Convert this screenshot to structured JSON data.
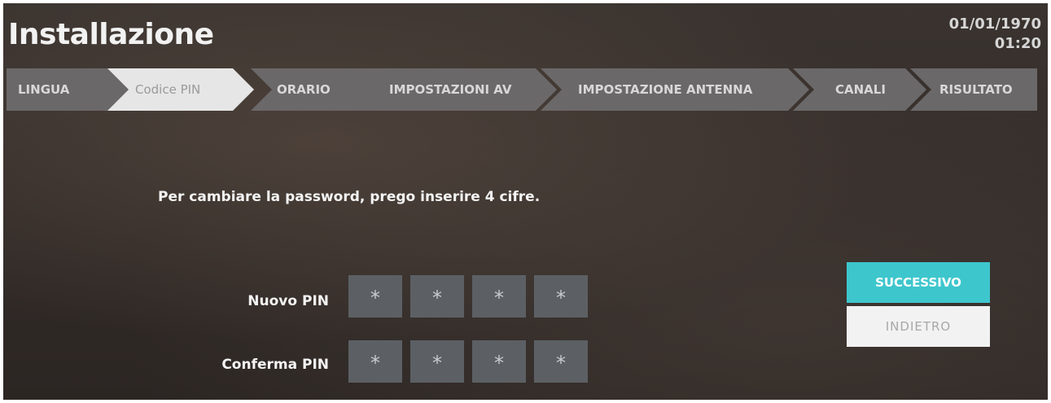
{
  "header": {
    "title": "Installazione",
    "date": "01/01/1970",
    "time": "01:20"
  },
  "steps": [
    {
      "label": "LINGUA",
      "active": false
    },
    {
      "label": "Codice PIN",
      "active": true
    },
    {
      "label": "ORARIO",
      "active": false
    },
    {
      "label": "IMPOSTAZIONI AV",
      "active": false
    },
    {
      "label": "IMPOSTAZIONE ANTENNA",
      "active": false
    },
    {
      "label": "CANALI",
      "active": false
    },
    {
      "label": "RISULTATO",
      "active": false
    }
  ],
  "main": {
    "prompt": "Per cambiare la password, prego inserire 4 cifre.",
    "new_pin": {
      "label": "Nuovo PIN",
      "digits": [
        "*",
        "*",
        "*",
        "*"
      ]
    },
    "confirm_pin": {
      "label": "Conferma PIN",
      "digits": [
        "*",
        "*",
        "*",
        "*"
      ]
    }
  },
  "buttons": {
    "next_label": "SUCCESSIVO",
    "back_label": "INDIETRO"
  },
  "colors": {
    "accent": "#3ec6cd",
    "step_inactive": "#6b6869",
    "step_active": "#e6e6e6",
    "pin_box": "#5c6064"
  }
}
